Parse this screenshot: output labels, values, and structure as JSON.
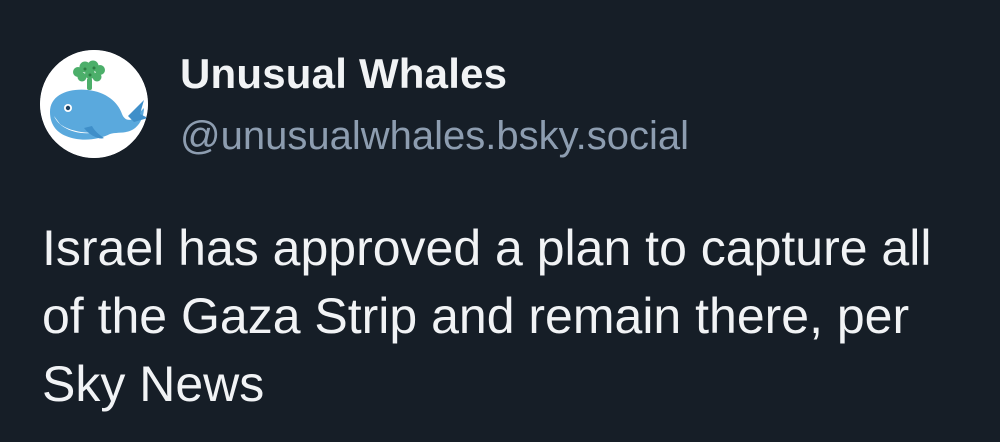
{
  "post": {
    "author": {
      "display_name": "Unusual Whales",
      "handle": "@unusualwhales.bsky.social",
      "avatar_icon": "whale-logo-icon"
    },
    "text": "Israel has approved a plan to capture all of the Gaza Strip and remain there, per Sky News"
  },
  "colors": {
    "background": "#161e27",
    "primary_text": "#f1f3f5",
    "handle_text": "#8d9db0",
    "whale_blue": "#5aa9dd",
    "money_green": "#4caf6a"
  }
}
